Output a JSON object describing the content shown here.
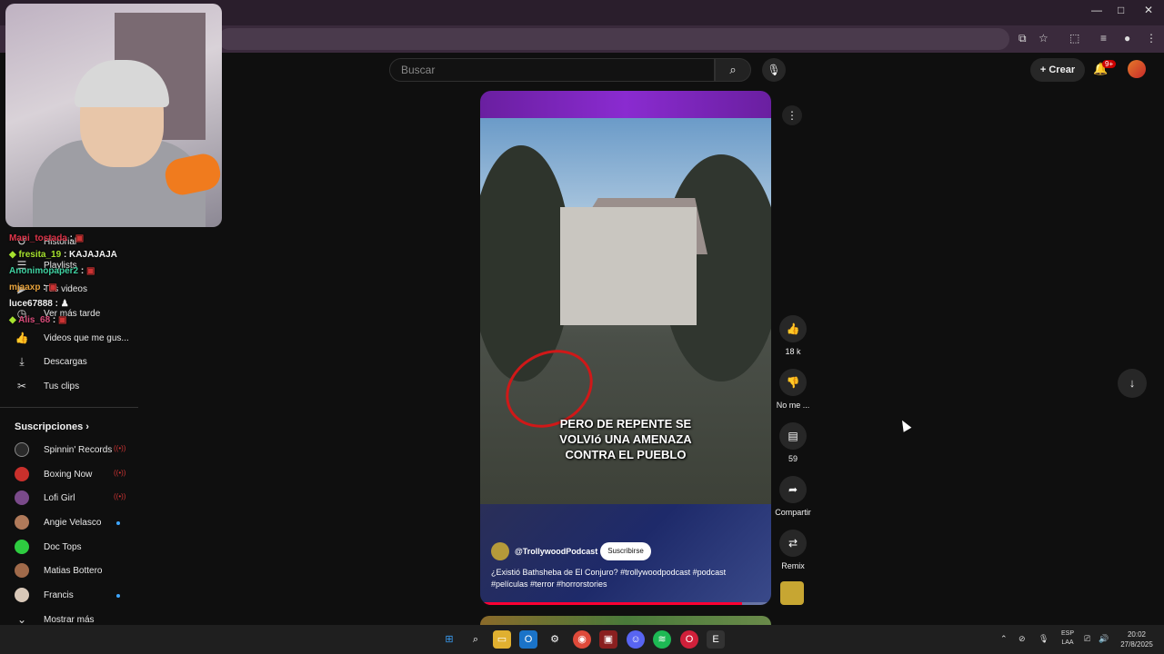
{
  "browser": {
    "window_controls": {
      "minimize": "—",
      "maximize": "□",
      "close": "✕"
    }
  },
  "header": {
    "search_placeholder": "Buscar",
    "create_label": "Crear",
    "notifications_badge": "9+"
  },
  "sidebar": {
    "items": [
      {
        "label": "Historial",
        "icon": "history-icon"
      },
      {
        "label": "Playlists",
        "icon": "playlist-icon"
      },
      {
        "label": "Tus videos",
        "icon": "video-icon"
      },
      {
        "label": "Ver más tarde",
        "icon": "clock-icon"
      },
      {
        "label": "Videos que me gus...",
        "icon": "thumbs-up-icon"
      },
      {
        "label": "Descargas",
        "icon": "download-icon"
      },
      {
        "label": "Tus clips",
        "icon": "scissors-icon"
      }
    ],
    "subscriptions_title": "Suscripciones",
    "subscriptions": [
      {
        "label": "Spinnin' Records",
        "indicator": "live",
        "color": "#2a2a2a"
      },
      {
        "label": "Boxing Now",
        "indicator": "live",
        "color": "#c9302c"
      },
      {
        "label": "Lofi Girl",
        "indicator": "live",
        "color": "#7a4a8a"
      },
      {
        "label": "Angie Velasco",
        "indicator": "new",
        "color": "#b07a5a"
      },
      {
        "label": "Doc Tops",
        "indicator": "none",
        "color": "#2ecc40"
      },
      {
        "label": "Matias Bottero",
        "indicator": "none",
        "color": "#a06a4a"
      },
      {
        "label": "Francis",
        "indicator": "new",
        "color": "#d8c8b8"
      }
    ],
    "show_more": "Mostrar más"
  },
  "chat": [
    {
      "user": "Mani_tostada",
      "text": " : ",
      "color": "#e0354a"
    },
    {
      "user": "fresita_19",
      "text": " : KAJAJAJA",
      "color": "#a6e22e"
    },
    {
      "user": "Anonimopaper2",
      "text": " : ",
      "color": "#3fd0a0"
    },
    {
      "user": "mjaaxp",
      "text": " : ",
      "color": "#e6a23c"
    },
    {
      "user": "luce67888",
      "text": " : ",
      "color": "#f0f0f0"
    },
    {
      "user": "Alis_68",
      "text": " : ",
      "color": "#d94c7a"
    }
  ],
  "short": {
    "caption_lines": [
      "PERO DE REPENTE SE",
      "VOLVIó UNA AMENAZA",
      "CONTRA EL PUEBLO"
    ],
    "channel": "@TrollywoodPodcast",
    "subscribe_label": "Suscribirse",
    "description": "¿Existió Bathsheba de El Conjuro? #trollywoodpodcast #podcast #películas #terror #horrorstories",
    "progress": 0.9
  },
  "actions": {
    "like_count": "18 k",
    "dislike_label": "No me ...",
    "comments_count": "59",
    "share_label": "Compartir",
    "remix_label": "Remix"
  },
  "taskbar": {
    "lang_line1": "ESP",
    "lang_line2": "LAA",
    "time": "20:02",
    "date": "27/8/2025"
  }
}
